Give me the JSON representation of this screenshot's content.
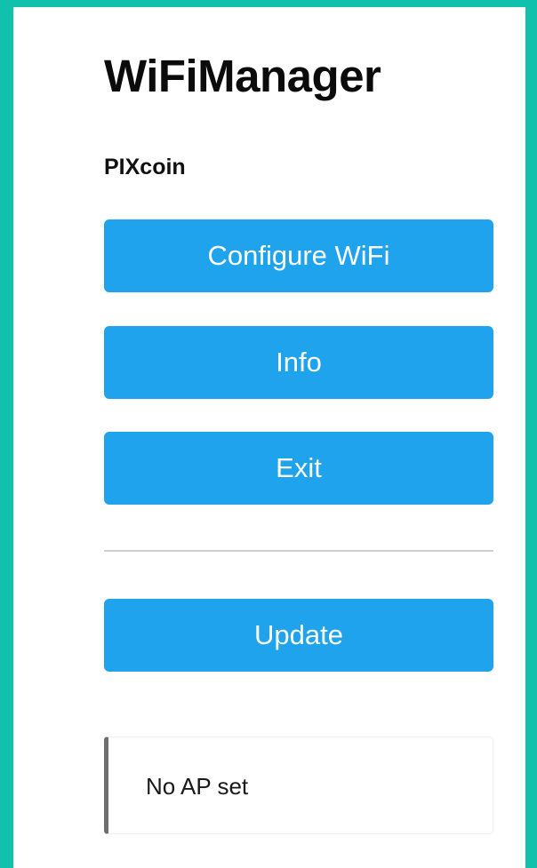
{
  "app": {
    "title": "WiFiManager",
    "device_name": "PIXcoin"
  },
  "buttons": {
    "configure_wifi": "Configure WiFi",
    "info": "Info",
    "exit": "Exit",
    "update": "Update"
  },
  "status": {
    "message": "No AP set"
  },
  "colors": {
    "frame": "#10c1ae",
    "button": "#1fa3ec",
    "message_accent": "#6f6f6f"
  }
}
